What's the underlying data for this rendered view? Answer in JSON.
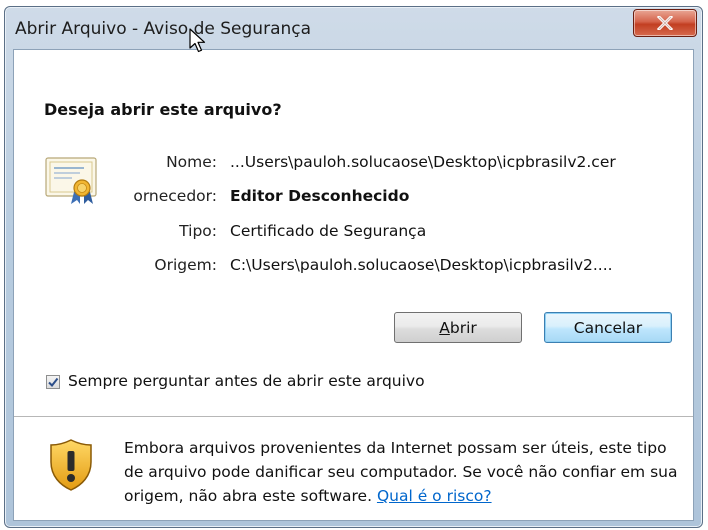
{
  "window": {
    "title": "Abrir Arquivo - Aviso de Segurança",
    "close_label": "X"
  },
  "dialog": {
    "heading": "Deseja abrir este arquivo?",
    "fields": [
      {
        "label": "Nome:",
        "value": "...Users\\pauloh.solucaose\\Desktop\\icpbrasilv2.cer",
        "bold": false
      },
      {
        "label": "ornecedor:",
        "value": "Editor Desconhecido",
        "bold": true
      },
      {
        "label": "Tipo:",
        "value": "Certificado de Segurança",
        "bold": false
      },
      {
        "label": "Origem:",
        "value": "C:\\Users\\pauloh.solucaose\\Desktop\\icpbrasilv2....",
        "bold": false
      }
    ],
    "buttons": {
      "open": {
        "accel": "A",
        "rest": "brir"
      },
      "cancel": "Cancelar"
    },
    "checkbox": {
      "label": "Sempre perguntar antes de abrir este arquivo",
      "checked": true
    },
    "warning": {
      "line1": "Embora arquivos provenientes da Internet possam ser úteis, este tipo",
      "line2": "de arquivo pode danificar seu computador. Se você não confiar em sua",
      "line3_prefix": "origem, não abra este software. ",
      "link": "Qual é o risco?"
    }
  },
  "colors": {
    "link": "#0066cc",
    "close_button": "#c23f22",
    "default_button_border": "#3c7fb1"
  },
  "icons": [
    "certificate-icon",
    "shield-warning-icon",
    "close-icon",
    "checkmark-icon",
    "mouse-cursor-icon"
  ]
}
